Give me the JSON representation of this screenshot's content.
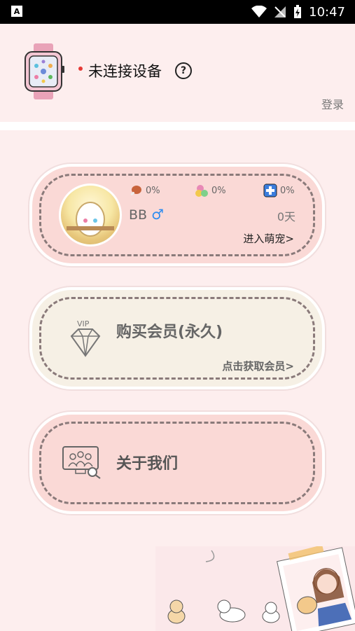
{
  "status_bar": {
    "time": "10:47",
    "left_icon_glyph": "A"
  },
  "header": {
    "device_status": "未连接设备",
    "help_glyph": "?",
    "login": "登录"
  },
  "pet": {
    "name": "BB",
    "gender_glyph": "♂",
    "hunger": "0%",
    "mood": "0%",
    "health": "0%",
    "days": "0天",
    "enter_label": "进入萌宠>"
  },
  "vip": {
    "badge": "VIP",
    "title": "购买会员(永久)",
    "link": "点击获取会员>"
  },
  "about": {
    "title": "关于我们"
  },
  "colors": {
    "page_bg": "#FDEEEE",
    "pink_card": "#FAD9D6",
    "cream_card": "#F6F0E5",
    "accent_blue": "#2D8CF0",
    "status_dot": "#E53935"
  }
}
